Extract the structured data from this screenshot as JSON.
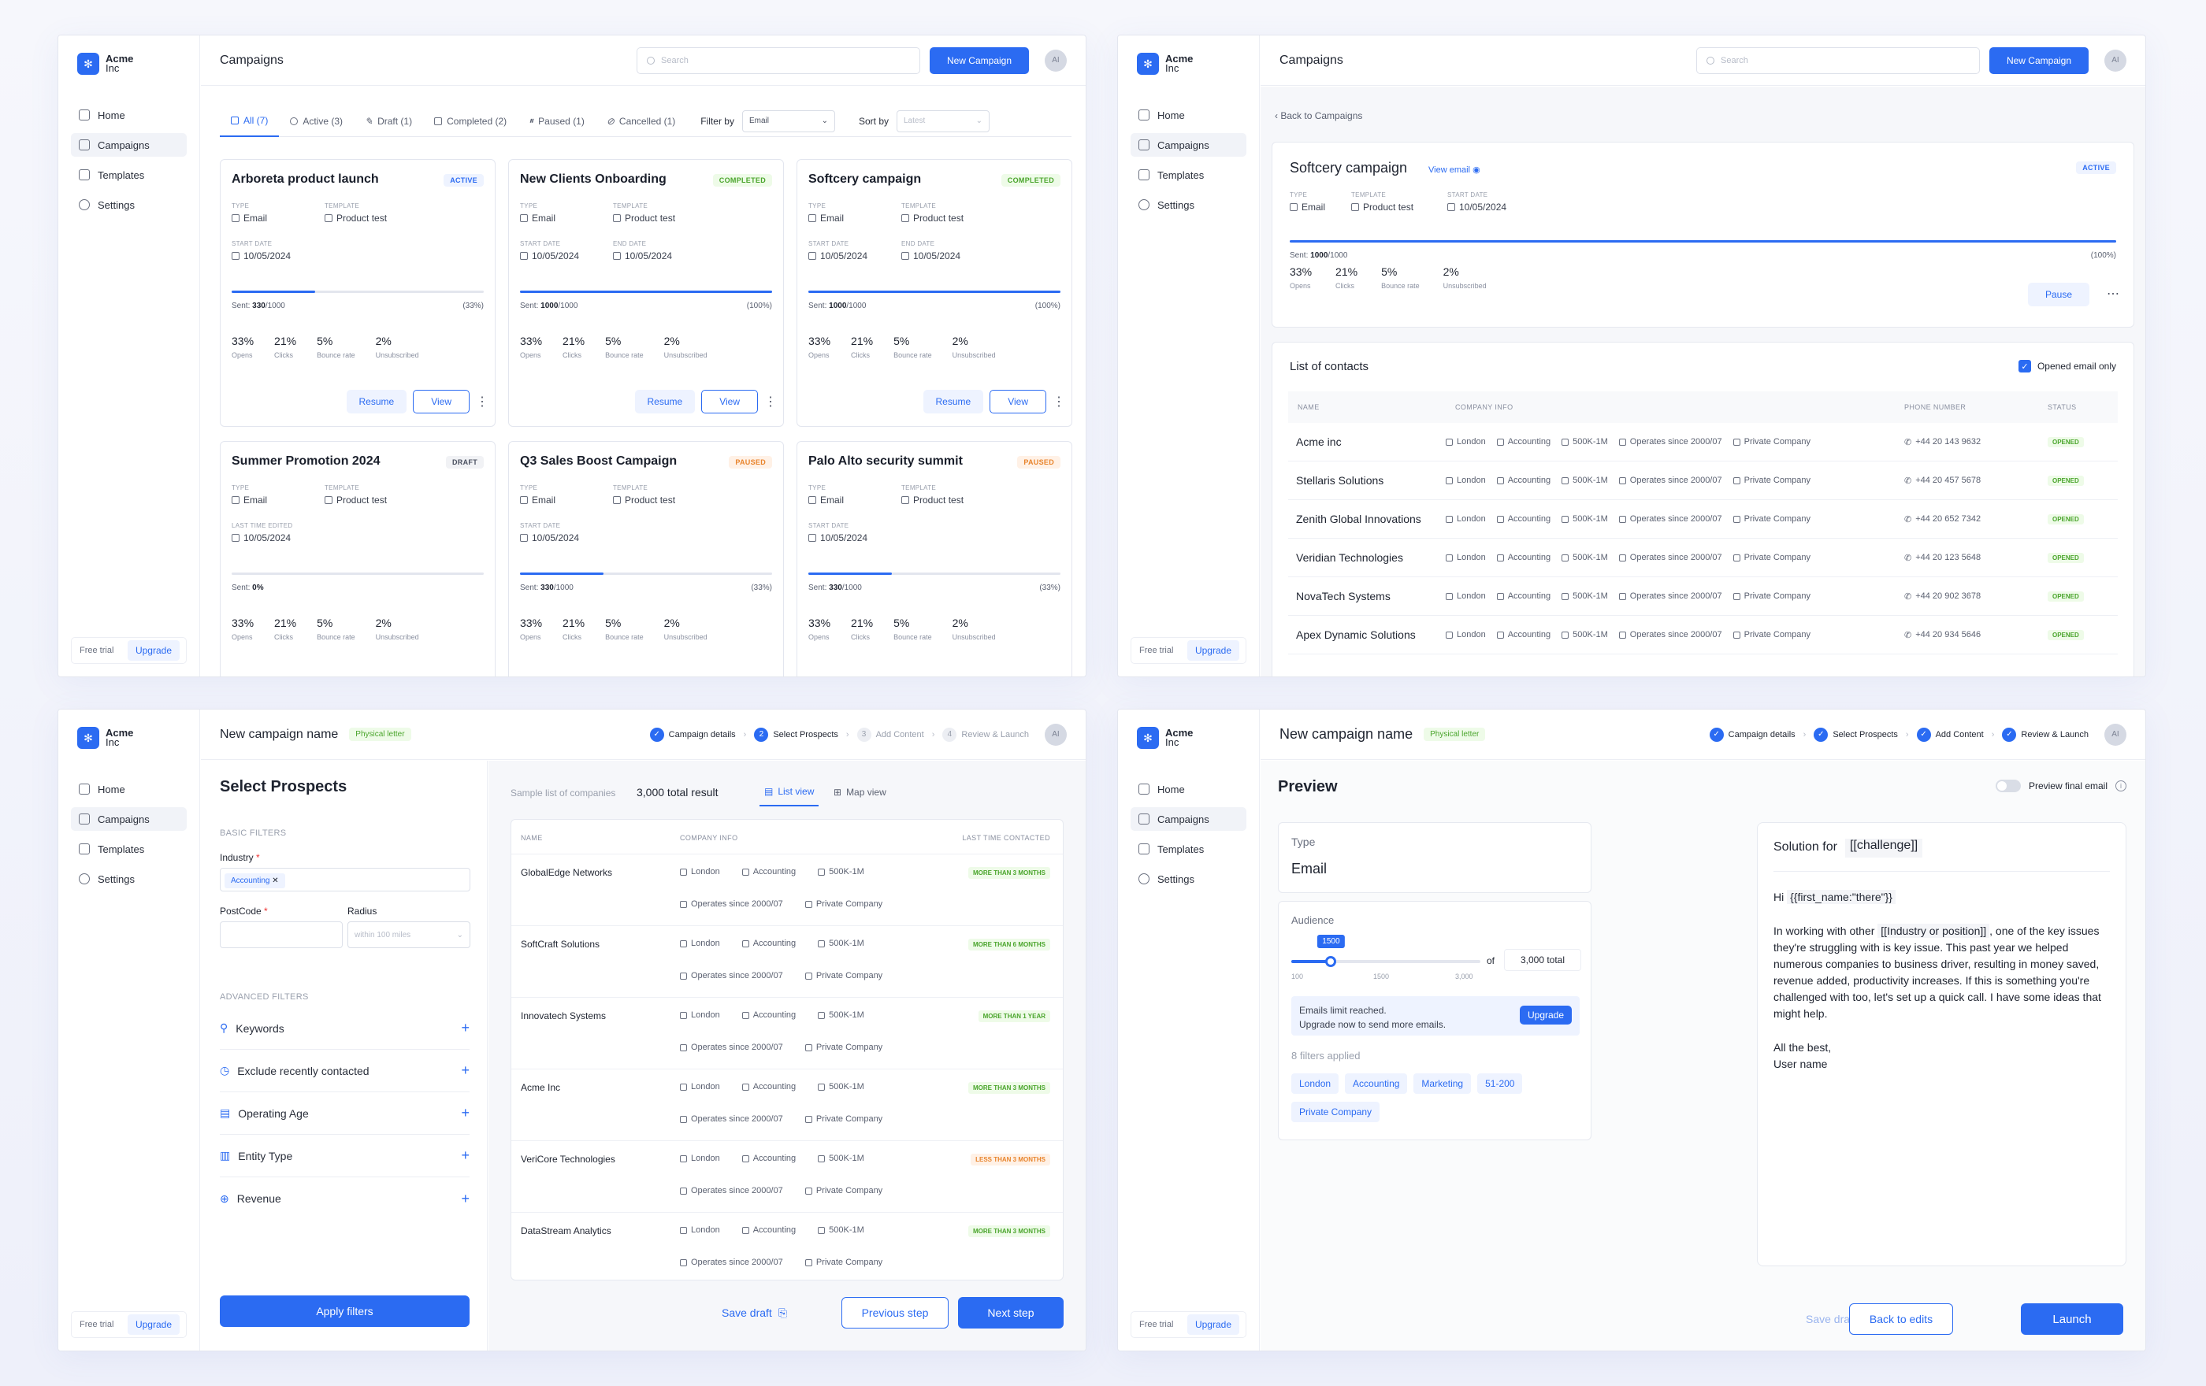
{
  "brand": {
    "name": "Acme",
    "sub": "Inc"
  },
  "nav": [
    "Home",
    "Campaigns",
    "Templates",
    "Settings"
  ],
  "footer": {
    "trial": "Free trial",
    "upgrade": "Upgrade"
  },
  "avatar": "AI",
  "colors": {
    "accent": "#2b6bf2",
    "success": "#4aa52c",
    "warning": "#e8842c"
  },
  "w1": {
    "title": "Campaigns",
    "search_placeholder": "Search",
    "new_campaign": "New Campaign",
    "tabs": [
      "All (7)",
      "Active (3)",
      "Draft (1)",
      "Completed (2)",
      "Paused (1)",
      "Cancelled (1)"
    ],
    "filter_label": "Filter by",
    "filter_value": "Email",
    "sort_label": "Sort by",
    "sort_value": "Latest",
    "cards": [
      {
        "title": "Arboreta product launch",
        "badge": "ACTIVE",
        "type_l": "TYPE",
        "type": "Email",
        "tpl_l": "TEMPLATE",
        "tpl": "Product test",
        "d1_l": "START DATE",
        "d1": "10/05/2024",
        "d2_l": "",
        "d2": "",
        "sent": "330",
        "total": "/1000",
        "pct_text": "(33%)",
        "progress": 0.33,
        "opens": "33%",
        "clicks": "21%",
        "bounce": "5%",
        "unsub": "2%",
        "btn1": "Resume",
        "btn2": "View"
      },
      {
        "title": "New Clients Onboarding",
        "badge": "COMPLETED",
        "type_l": "TYPE",
        "type": "Email",
        "tpl_l": "TEMPLATE",
        "tpl": "Product test",
        "d1_l": "START DATE",
        "d1": "10/05/2024",
        "d2_l": "END DATE",
        "d2": "10/05/2024",
        "sent": "1000",
        "total": "/1000",
        "pct_text": "(100%)",
        "progress": 1.0,
        "opens": "33%",
        "clicks": "21%",
        "bounce": "5%",
        "unsub": "2%",
        "btn1": "Resume",
        "btn2": "View"
      },
      {
        "title": "Softcery campaign",
        "badge": "COMPLETED",
        "type_l": "TYPE",
        "type": "Email",
        "tpl_l": "TEMPLATE",
        "tpl": "Product test",
        "d1_l": "START DATE",
        "d1": "10/05/2024",
        "d2_l": "END DATE",
        "d2": "10/05/2024",
        "sent": "1000",
        "total": "/1000",
        "pct_text": "(100%)",
        "progress": 1.0,
        "opens": "33%",
        "clicks": "21%",
        "bounce": "5%",
        "unsub": "2%",
        "btn1": "Resume",
        "btn2": "View"
      },
      {
        "title": "Summer Promotion 2024",
        "badge": "DRAFT",
        "type_l": "TYPE",
        "type": "Email",
        "tpl_l": "TEMPLATE",
        "tpl": "Product test",
        "d1_l": "LAST TIME EDITED",
        "d1": "10/05/2024",
        "d2_l": "",
        "d2": "",
        "sent": "0%",
        "total": "",
        "pct_text": "",
        "progress": 0.0,
        "opens": "33%",
        "clicks": "21%",
        "bounce": "5%",
        "unsub": "2%",
        "btn1": "",
        "btn2": ""
      },
      {
        "title": "Q3 Sales Boost Campaign",
        "badge": "PAUSED",
        "type_l": "TYPE",
        "type": "Email",
        "tpl_l": "TEMPLATE",
        "tpl": "Product test",
        "d1_l": "START DATE",
        "d1": "10/05/2024",
        "d2_l": "",
        "d2": "",
        "sent": "330",
        "total": "/1000",
        "pct_text": "(33%)",
        "progress": 0.33,
        "opens": "33%",
        "clicks": "21%",
        "bounce": "5%",
        "unsub": "2%",
        "btn1": "",
        "btn2": ""
      },
      {
        "title": "Palo Alto security summit",
        "badge": "PAUSED",
        "type_l": "TYPE",
        "type": "Email",
        "tpl_l": "TEMPLATE",
        "tpl": "Product test",
        "d1_l": "START DATE",
        "d1": "10/05/2024",
        "d2_l": "",
        "d2": "",
        "sent": "330",
        "total": "/1000",
        "pct_text": "(33%)",
        "progress": 0.33,
        "opens": "33%",
        "clicks": "21%",
        "bounce": "5%",
        "unsub": "2%",
        "btn1": "",
        "btn2": ""
      }
    ],
    "stat_labels": [
      "Opens",
      "Clicks",
      "Bounce rate",
      "Unsubscribed"
    ],
    "sent_label": "Sent:"
  },
  "w2": {
    "title": "Campaigns",
    "search_placeholder": "Search",
    "new_campaign": "New Campaign",
    "back": "Back to Campaigns",
    "camp_title": "Softcery campaign",
    "view_email": "View email",
    "badge": "ACTIVE",
    "type_l": "TYPE",
    "type": "Email",
    "tpl_l": "TEMPLATE",
    "tpl": "Product test",
    "date_l": "START DATE",
    "date": "10/05/2024",
    "sent_label": "Sent:",
    "sent": "1000",
    "total": "/1000",
    "pct_text": "(100%)",
    "progress": 1.0,
    "stats": [
      {
        "v": "33%",
        "l": "Opens"
      },
      {
        "v": "21%",
        "l": "Clicks"
      },
      {
        "v": "5%",
        "l": "Bounce rate"
      },
      {
        "v": "2%",
        "l": "Unsubscribed"
      }
    ],
    "pause": "Pause",
    "contacts_title": "List of contacts",
    "opened_only": "Opened email only",
    "cols": [
      "NAME",
      "COMPANY INFO",
      "PHONE NUMBER",
      "STATUS"
    ],
    "info": [
      "London",
      "Accounting",
      "500K-1M",
      "Operates since 2000/07",
      "Private Company"
    ],
    "status": "OPENED",
    "contacts": [
      {
        "name": "Acme inc",
        "phone": "+44 20 143 9632"
      },
      {
        "name": "Stellaris Solutions",
        "phone": "+44 20 457 5678"
      },
      {
        "name": "Zenith Global Innovations",
        "phone": "+44 20 652 7342"
      },
      {
        "name": "Veridian Technologies",
        "phone": "+44 20 123 5648"
      },
      {
        "name": "NovaTech Systems",
        "phone": "+44 20 902 3678"
      },
      {
        "name": "Apex Dynamic Solutions",
        "phone": "+44 20 934 5646"
      }
    ]
  },
  "w3": {
    "title": "New campaign name",
    "tag": "Physical letter",
    "steps": [
      {
        "n": "1",
        "label": "Campaign details",
        "state": "done"
      },
      {
        "n": "2",
        "label": "Select Prospects",
        "state": "current"
      },
      {
        "n": "3",
        "label": "Add Content",
        "state": "todo"
      },
      {
        "n": "4",
        "label": "Review & Launch",
        "state": "todo"
      }
    ],
    "heading": "Select Prospects",
    "basic": "BASIC FILTERS",
    "industry_l": "Industry",
    "industry_chip": "Accounting",
    "postcode_l": "PostCode",
    "radius_l": "Radius",
    "radius_ph": "within 100 miles",
    "advanced": "ADVANCED FILTERS",
    "filters": [
      "Keywords",
      "Exclude recently contacted",
      "Operating Age",
      "Entity Type",
      "Revenue"
    ],
    "apply": "Apply filters",
    "sample": "Sample list of companies",
    "total": "3,000 total result",
    "list_view": "List view",
    "map_view": "Map view",
    "cols": [
      "NAME",
      "COMPANY INFO",
      "LAST TIME CONTACTED"
    ],
    "info1": [
      "London",
      "Accounting",
      "500K-1M"
    ],
    "info2": [
      "Operates since 2000/07",
      "Private Company"
    ],
    "rows": [
      {
        "name": "GlobalEdge Networks",
        "lt": "MORE THAN 3 MONTHS",
        "warn": false
      },
      {
        "name": "SoftCraft Solutions",
        "lt": "MORE THAN 6 MONTHS",
        "warn": false
      },
      {
        "name": "Innovatech Systems",
        "lt": "MORE THAN 1 YEAR",
        "warn": false
      },
      {
        "name": "Acme Inc",
        "lt": "MORE THAN 3 MONTHS",
        "warn": false
      },
      {
        "name": "VeriCore Technologies",
        "lt": "LESS THAN 3 MONTHS",
        "warn": true
      },
      {
        "name": "DataStream Analytics",
        "lt": "MORE THAN 3 MONTHS",
        "warn": false
      }
    ],
    "save": "Save draft",
    "prev": "Previous step",
    "next": "Next step"
  },
  "w4": {
    "title": "New campaign name",
    "tag": "Physical letter",
    "steps": [
      {
        "n": "1",
        "label": "Campaign details"
      },
      {
        "n": "2",
        "label": "Select Prospects"
      },
      {
        "n": "3",
        "label": "Add Content"
      },
      {
        "n": "4",
        "label": "Review & Launch"
      }
    ],
    "heading": "Preview",
    "preview_toggle": "Preview final email",
    "type_l": "Type",
    "type": "Email",
    "audience_l": "Audience",
    "slider_value": "1500",
    "slider_fraction": 0.21,
    "ticks": [
      "100",
      "1500",
      "3,000"
    ],
    "of": "of",
    "total": "3,000 total",
    "limit1": "Emails limit reached.",
    "limit2": "Upgrade now to send more emails.",
    "upgrade": "Upgrade",
    "filters_applied": "8 filters applied",
    "chips": [
      "London",
      "Accounting",
      "Marketing",
      "51-200",
      "Private Company"
    ],
    "subject_prefix": "Solution for",
    "subject_var": "[[challenge]]",
    "greet": "Hi",
    "greet_var": "{{first_name:\"there\"}}",
    "body_pre": "In working with other",
    "body_var": "[[Industry or position]]",
    "body_post": ", one of the key issues they're struggling with is key issue. This past year we helped numerous companies to business driver, resulting in money saved, revenue added, productivity increases. If this is something you're challenged with too, let's set up a quick call. I have some ideas that might help.",
    "sign1": "All the best,",
    "sign2": "User name",
    "save": "Save draft",
    "back": "Back to edits",
    "launch": "Launch"
  }
}
